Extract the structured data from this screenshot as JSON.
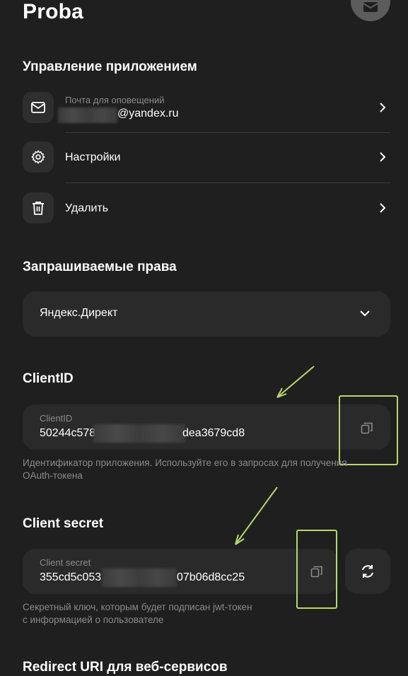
{
  "app": {
    "title": "Proba"
  },
  "management": {
    "title": "Управление приложением",
    "notify": {
      "label": "Почта для оповещений",
      "value_suffix": "@yandex.ru"
    },
    "settings": {
      "label": "Настройки"
    },
    "delete": {
      "label": "Удалить"
    }
  },
  "permissions": {
    "title": "Запрашиваемые права",
    "selected": "Яндекс.Директ"
  },
  "client_id": {
    "title": "ClientID",
    "label": "ClientID",
    "value_start": "50244c578",
    "value_end": "dea3679cd8",
    "hint": "Идентификатор приложения. Используйте его в запросах для получения OAuth-токена"
  },
  "client_secret": {
    "title": "Client secret",
    "label": "Client secret",
    "value_start": "355cd5c053",
    "value_end": "07b06d8cc25",
    "hint_line1": "Секретный ключ, которым будет подписан jwt-токен",
    "hint_line2": "с информацией о пользователе"
  },
  "redirect": {
    "title": "Redirect URI для веб-сервисов"
  },
  "colors": {
    "background": "#1f1f1f",
    "card": "#2a2a2a",
    "highlight": "#b8d86a",
    "muted_text": "#8a8a8a"
  }
}
